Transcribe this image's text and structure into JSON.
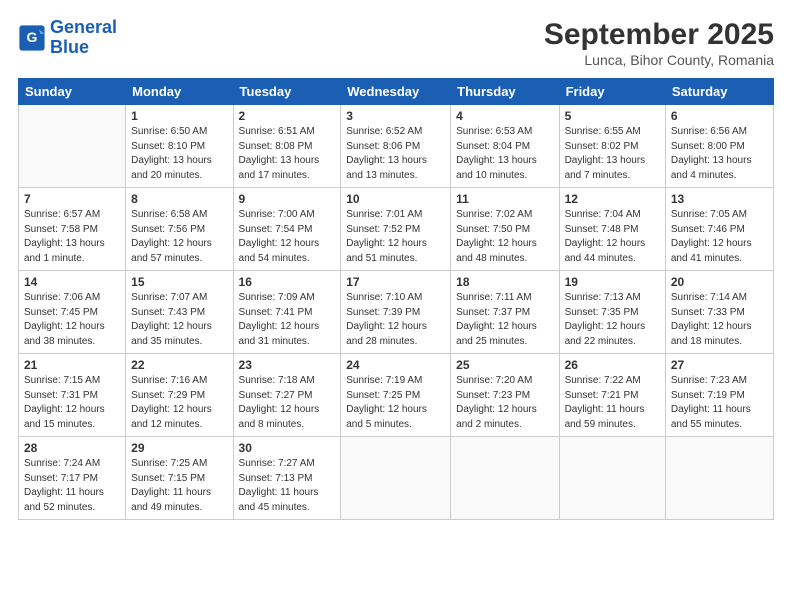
{
  "header": {
    "logo_line1": "General",
    "logo_line2": "Blue",
    "month_title": "September 2025",
    "subtitle": "Lunca, Bihor County, Romania"
  },
  "days_of_week": [
    "Sunday",
    "Monday",
    "Tuesday",
    "Wednesday",
    "Thursday",
    "Friday",
    "Saturday"
  ],
  "weeks": [
    [
      {
        "day": "",
        "info": ""
      },
      {
        "day": "1",
        "info": "Sunrise: 6:50 AM\nSunset: 8:10 PM\nDaylight: 13 hours\nand 20 minutes."
      },
      {
        "day": "2",
        "info": "Sunrise: 6:51 AM\nSunset: 8:08 PM\nDaylight: 13 hours\nand 17 minutes."
      },
      {
        "day": "3",
        "info": "Sunrise: 6:52 AM\nSunset: 8:06 PM\nDaylight: 13 hours\nand 13 minutes."
      },
      {
        "day": "4",
        "info": "Sunrise: 6:53 AM\nSunset: 8:04 PM\nDaylight: 13 hours\nand 10 minutes."
      },
      {
        "day": "5",
        "info": "Sunrise: 6:55 AM\nSunset: 8:02 PM\nDaylight: 13 hours\nand 7 minutes."
      },
      {
        "day": "6",
        "info": "Sunrise: 6:56 AM\nSunset: 8:00 PM\nDaylight: 13 hours\nand 4 minutes."
      }
    ],
    [
      {
        "day": "7",
        "info": "Sunrise: 6:57 AM\nSunset: 7:58 PM\nDaylight: 13 hours\nand 1 minute."
      },
      {
        "day": "8",
        "info": "Sunrise: 6:58 AM\nSunset: 7:56 PM\nDaylight: 12 hours\nand 57 minutes."
      },
      {
        "day": "9",
        "info": "Sunrise: 7:00 AM\nSunset: 7:54 PM\nDaylight: 12 hours\nand 54 minutes."
      },
      {
        "day": "10",
        "info": "Sunrise: 7:01 AM\nSunset: 7:52 PM\nDaylight: 12 hours\nand 51 minutes."
      },
      {
        "day": "11",
        "info": "Sunrise: 7:02 AM\nSunset: 7:50 PM\nDaylight: 12 hours\nand 48 minutes."
      },
      {
        "day": "12",
        "info": "Sunrise: 7:04 AM\nSunset: 7:48 PM\nDaylight: 12 hours\nand 44 minutes."
      },
      {
        "day": "13",
        "info": "Sunrise: 7:05 AM\nSunset: 7:46 PM\nDaylight: 12 hours\nand 41 minutes."
      }
    ],
    [
      {
        "day": "14",
        "info": "Sunrise: 7:06 AM\nSunset: 7:45 PM\nDaylight: 12 hours\nand 38 minutes."
      },
      {
        "day": "15",
        "info": "Sunrise: 7:07 AM\nSunset: 7:43 PM\nDaylight: 12 hours\nand 35 minutes."
      },
      {
        "day": "16",
        "info": "Sunrise: 7:09 AM\nSunset: 7:41 PM\nDaylight: 12 hours\nand 31 minutes."
      },
      {
        "day": "17",
        "info": "Sunrise: 7:10 AM\nSunset: 7:39 PM\nDaylight: 12 hours\nand 28 minutes."
      },
      {
        "day": "18",
        "info": "Sunrise: 7:11 AM\nSunset: 7:37 PM\nDaylight: 12 hours\nand 25 minutes."
      },
      {
        "day": "19",
        "info": "Sunrise: 7:13 AM\nSunset: 7:35 PM\nDaylight: 12 hours\nand 22 minutes."
      },
      {
        "day": "20",
        "info": "Sunrise: 7:14 AM\nSunset: 7:33 PM\nDaylight: 12 hours\nand 18 minutes."
      }
    ],
    [
      {
        "day": "21",
        "info": "Sunrise: 7:15 AM\nSunset: 7:31 PM\nDaylight: 12 hours\nand 15 minutes."
      },
      {
        "day": "22",
        "info": "Sunrise: 7:16 AM\nSunset: 7:29 PM\nDaylight: 12 hours\nand 12 minutes."
      },
      {
        "day": "23",
        "info": "Sunrise: 7:18 AM\nSunset: 7:27 PM\nDaylight: 12 hours\nand 8 minutes."
      },
      {
        "day": "24",
        "info": "Sunrise: 7:19 AM\nSunset: 7:25 PM\nDaylight: 12 hours\nand 5 minutes."
      },
      {
        "day": "25",
        "info": "Sunrise: 7:20 AM\nSunset: 7:23 PM\nDaylight: 12 hours\nand 2 minutes."
      },
      {
        "day": "26",
        "info": "Sunrise: 7:22 AM\nSunset: 7:21 PM\nDaylight: 11 hours\nand 59 minutes."
      },
      {
        "day": "27",
        "info": "Sunrise: 7:23 AM\nSunset: 7:19 PM\nDaylight: 11 hours\nand 55 minutes."
      }
    ],
    [
      {
        "day": "28",
        "info": "Sunrise: 7:24 AM\nSunset: 7:17 PM\nDaylight: 11 hours\nand 52 minutes."
      },
      {
        "day": "29",
        "info": "Sunrise: 7:25 AM\nSunset: 7:15 PM\nDaylight: 11 hours\nand 49 minutes."
      },
      {
        "day": "30",
        "info": "Sunrise: 7:27 AM\nSunset: 7:13 PM\nDaylight: 11 hours\nand 45 minutes."
      },
      {
        "day": "",
        "info": ""
      },
      {
        "day": "",
        "info": ""
      },
      {
        "day": "",
        "info": ""
      },
      {
        "day": "",
        "info": ""
      }
    ]
  ]
}
